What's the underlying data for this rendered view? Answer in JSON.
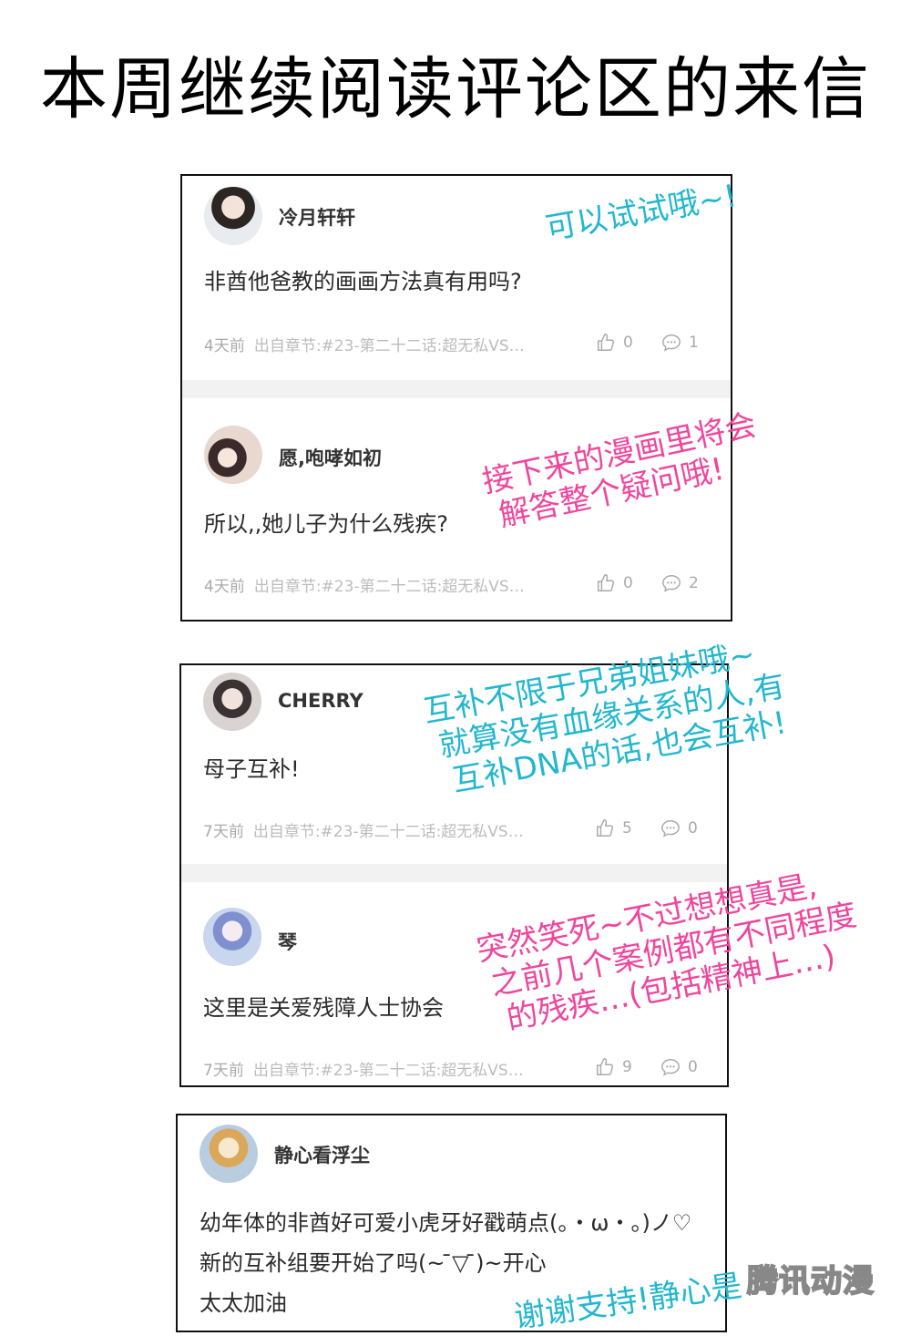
{
  "page_title": "本周继续阅读评论区的来信",
  "comments": [
    {
      "username": "冷月轩轩",
      "text": "非酋他爸教的画画方法真有用吗?",
      "time": "4天前",
      "source": "出自章节:#23-第二十二话:超无私VS…",
      "likes": "0",
      "replies": "1"
    },
    {
      "username": "愿,咆哮如初",
      "text": "所以,,她儿子为什么残疾?",
      "time": "4天前",
      "source": "出自章节:#23-第二十二话:超无私VS…",
      "likes": "0",
      "replies": "2"
    },
    {
      "username": "CHERRY",
      "text": "母子互补!",
      "time": "7天前",
      "source": "出自章节:#23-第二十二话:超无私VS…",
      "likes": "5",
      "replies": "0"
    },
    {
      "username": "琴",
      "text": "这里是关爱残障人士协会",
      "time": "7天前",
      "source": "出自章节:#23-第二十二话:超无私VS…",
      "likes": "9",
      "replies": "0"
    },
    {
      "username": "静心看浮尘",
      "text_lines": [
        "幼年体的非酋好可爱小虎牙好戳萌点(。・ω・。)ノ♡",
        "新的互补组要开始了吗(~ ̄▽ ̄)~开心",
        "太太加油"
      ]
    }
  ],
  "author_notes": [
    {
      "lines": [
        "可以试试哦~!"
      ],
      "color": "#22b7cf"
    },
    {
      "lines": [
        "接下来的漫画里将会",
        "解答整个疑问哦!"
      ],
      "color": "#f0459d"
    },
    {
      "lines": [
        "互补不限于兄弟姐妹哦~",
        "就算没有血缘关系的人,有",
        "互补DNA的话,也会互补!"
      ],
      "color": "#22b7cf"
    },
    {
      "lines": [
        "突然笑死~不过想想真是,",
        "之前几个案例都有不同程度",
        "的残疾…(包括精神上…)"
      ],
      "color": "#f0459d"
    },
    {
      "lines": [
        "谢谢支持!静心是"
      ],
      "color": "#22b7cf"
    }
  ],
  "watermark": "腾讯动漫",
  "icons": {
    "like": "thumbs-up-icon",
    "reply": "comment-bubble-icon"
  }
}
